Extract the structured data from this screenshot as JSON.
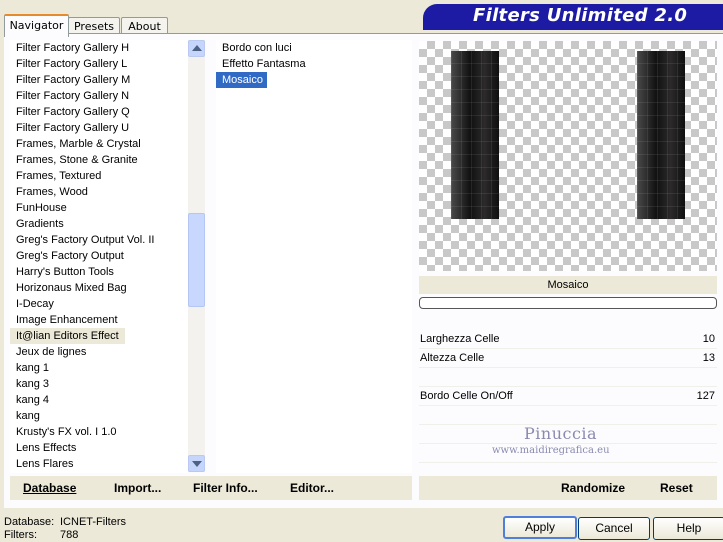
{
  "tabs": [
    {
      "label": "Navigator",
      "active": true
    },
    {
      "label": "Presets",
      "active": false
    },
    {
      "label": "About",
      "active": false
    }
  ],
  "banner_title": "Filters Unlimited 2.0",
  "categories": [
    "Filter Factory Gallery H",
    "Filter Factory Gallery L",
    "Filter Factory Gallery M",
    "Filter Factory Gallery N",
    "Filter Factory Gallery Q",
    "Filter Factory Gallery U",
    "Frames, Marble & Crystal",
    "Frames, Stone & Granite",
    "Frames, Textured",
    "Frames, Wood",
    "FunHouse",
    "Gradients",
    "Greg's Factory Output Vol. II",
    "Greg's Factory Output",
    "Harry's Button Tools",
    "Horizonaus Mixed Bag",
    "I-Decay",
    "Image Enhancement",
    "It@lian Editors Effect",
    "Jeux de lignes",
    "kang 1",
    "kang 3",
    "kang 4",
    "kang",
    "Krusty's FX vol. I 1.0",
    "Lens Effects",
    "Lens Flares"
  ],
  "selected_category": "It@lian Editors Effect",
  "filters": [
    "Bordo con luci",
    "Effetto Fantasma",
    "Mosaico"
  ],
  "selected_filter": "Mosaico",
  "preview_filter_name": "Mosaico",
  "parameters": [
    {
      "label": "Larghezza Celle",
      "value": "10"
    },
    {
      "label": "Altezza Celle",
      "value": "13"
    },
    {
      "label": "",
      "value": ""
    },
    {
      "label": "Bordo Celle On/Off",
      "value": "127"
    }
  ],
  "watermark": {
    "name": "Pinuccia",
    "url": "www.maidiregrafica.eu"
  },
  "left_buttons": [
    "Database",
    "Import...",
    "Filter Info...",
    "Editor..."
  ],
  "right_links": [
    "Randomize",
    "Reset"
  ],
  "status": {
    "database_label": "Database:",
    "database_value": "ICNET-Filters",
    "filters_label": "Filters:",
    "filters_value": "788"
  },
  "dialog_buttons": {
    "apply": "Apply",
    "cancel": "Cancel",
    "help": "Help"
  }
}
